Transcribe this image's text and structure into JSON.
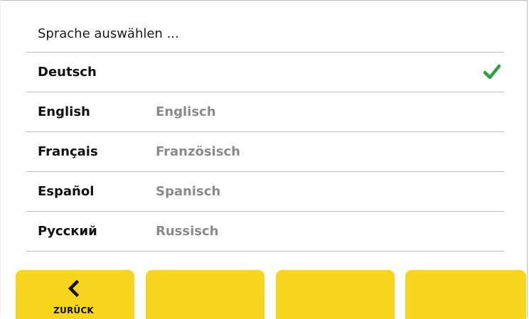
{
  "header": {
    "title": "Sprache auswählen ..."
  },
  "languages": [
    {
      "name": "Deutsch",
      "translation": "",
      "selected": true
    },
    {
      "name": "English",
      "translation": "Englisch",
      "selected": false
    },
    {
      "name": "Français",
      "translation": "Französisch",
      "selected": false
    },
    {
      "name": "Español",
      "translation": "Spanisch",
      "selected": false
    },
    {
      "name": "Русский",
      "translation": "Russisch",
      "selected": false
    }
  ],
  "footer": {
    "back_label": "ZURÜCK",
    "back_icon": "chevron-left-icon"
  },
  "colors": {
    "accent_yellow": "#f7d51d",
    "check_green": "#2aa33a",
    "secondary_text": "#8a8a8a"
  }
}
